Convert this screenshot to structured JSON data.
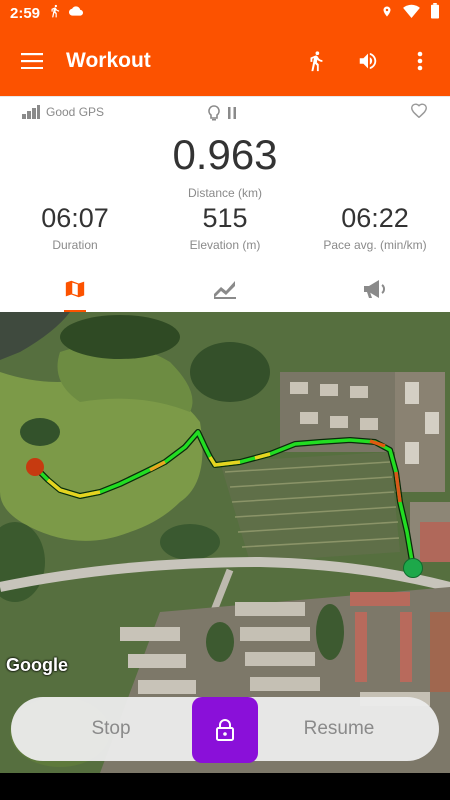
{
  "status_bar": {
    "time": "2:59",
    "icons_left": [
      "running-icon",
      "cloud-icon"
    ],
    "icons_right": [
      "location-icon",
      "wifi-icon",
      "battery-icon"
    ]
  },
  "app_bar": {
    "title": "Workout",
    "background": "#fc5200",
    "actions": [
      "activity-type-icon",
      "volume-icon",
      "more-icon"
    ]
  },
  "stats": {
    "gps_status": "Good GPS",
    "distance_value": "0.963",
    "distance_label": "Distance (km)",
    "metrics": [
      {
        "value": "06:07",
        "label": "Duration"
      },
      {
        "value": "515",
        "label": "Elevation (m)"
      },
      {
        "value": "06:22",
        "label": "Pace avg. (min/km)"
      }
    ],
    "tabs": [
      {
        "icon": "map-icon",
        "active": true
      },
      {
        "icon": "chart-icon",
        "active": false
      },
      {
        "icon": "megaphone-icon",
        "active": false
      }
    ]
  },
  "map": {
    "attribution": "Google",
    "route_color": "#22dd22",
    "start_marker_color": "#c63a10",
    "end_marker_color": "#1da84a"
  },
  "controls": {
    "stop_label": "Stop",
    "resume_label": "Resume",
    "lock_color": "#8a10d9"
  }
}
